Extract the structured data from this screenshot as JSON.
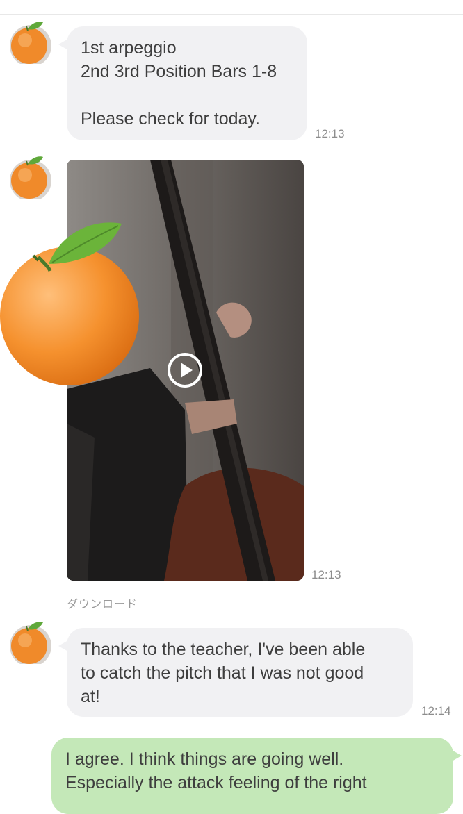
{
  "messages": [
    {
      "sender": "contact",
      "lines": [
        "1st arpeggio",
        "2nd 3rd Position Bars 1-8",
        "",
        "Please check for today."
      ],
      "time": "12:13"
    },
    {
      "sender": "contact",
      "type": "video",
      "time": "12:13",
      "download_label": "ダウンロード"
    },
    {
      "sender": "contact",
      "lines": [
        "Thanks to the teacher, I've been able",
        "to catch the pitch that I was not good",
        "at!"
      ],
      "time": "12:14"
    },
    {
      "sender": "me",
      "lines": [
        "I agree. I think things are going well.",
        "Especially the attack feeling of the right"
      ]
    }
  ],
  "colors": {
    "incoming_bubble": "#f1f1f3",
    "outgoing_bubble": "#c4e8b8",
    "timestamp": "#8d8d8d"
  },
  "icons": {
    "avatar": "orange-emoji-icon",
    "video_play": "play-circle-icon"
  }
}
